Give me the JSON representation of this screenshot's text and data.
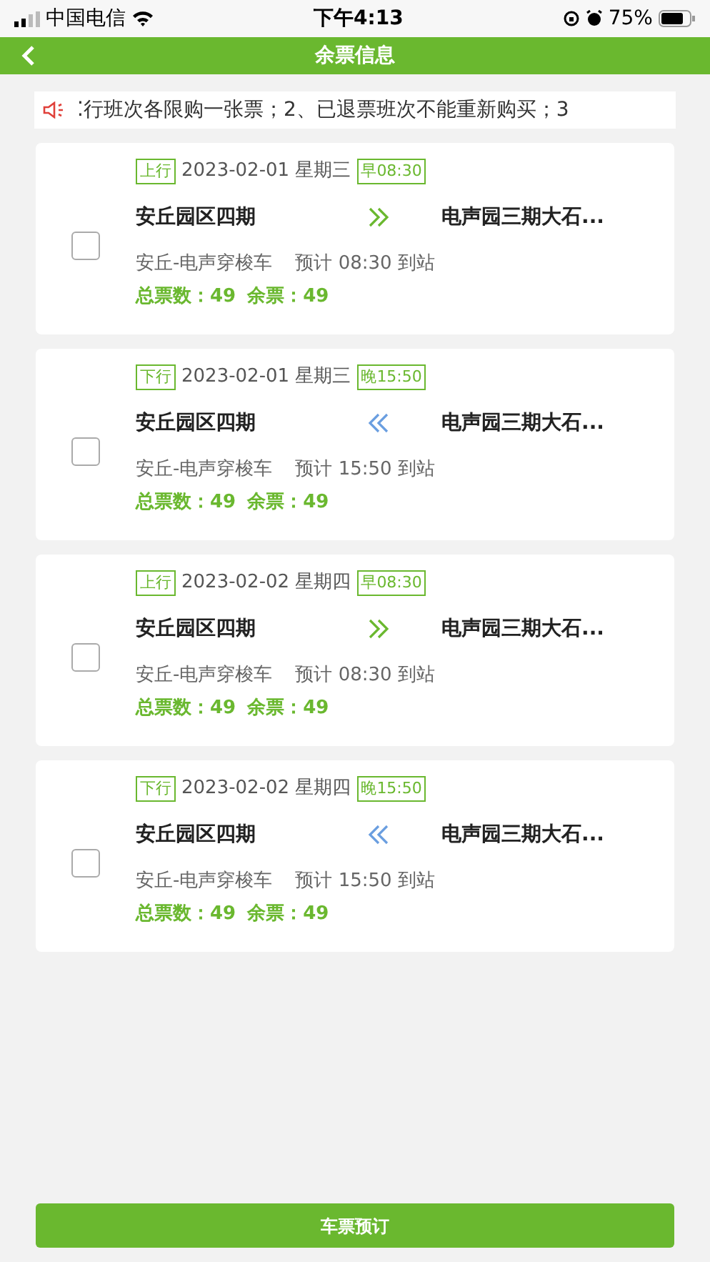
{
  "status_bar": {
    "carrier": "中国电信",
    "time": "下午4:13",
    "battery": "75%"
  },
  "header": {
    "title": "余票信息"
  },
  "notice": "⁚行班次各限购一张票；2、已退票班次不能重新购买；3",
  "trips": [
    {
      "direction_label": "上行",
      "kind": "up",
      "date": "2023-02-01 星期三",
      "time_tag": "早08:30",
      "from": "安丘园区四期",
      "to": "电声园三期大石...",
      "route": "安丘-电声穿梭车",
      "eta": "预计 08:30 到站",
      "total": "总票数：49",
      "remaining": "余票：49",
      "checked": false
    },
    {
      "direction_label": "下行",
      "kind": "down",
      "date": "2023-02-01 星期三",
      "time_tag": "晚15:50",
      "from": "安丘园区四期",
      "to": "电声园三期大石...",
      "route": "安丘-电声穿梭车",
      "eta": "预计 15:50 到站",
      "total": "总票数：49",
      "remaining": "余票：49",
      "checked": false
    },
    {
      "direction_label": "上行",
      "kind": "up",
      "date": "2023-02-02 星期四",
      "time_tag": "早08:30",
      "from": "安丘园区四期",
      "to": "电声园三期大石...",
      "route": "安丘-电声穿梭车",
      "eta": "预计 08:30 到站",
      "total": "总票数：49",
      "remaining": "余票：49",
      "checked": false
    },
    {
      "direction_label": "下行",
      "kind": "down",
      "date": "2023-02-02 星期四",
      "time_tag": "晚15:50",
      "from": "安丘园区四期",
      "to": "电声园三期大石...",
      "route": "安丘-电声穿梭车",
      "eta": "预计 15:50 到站",
      "total": "总票数：49",
      "remaining": "余票：49",
      "checked": false
    }
  ],
  "book_button": "车票预订"
}
